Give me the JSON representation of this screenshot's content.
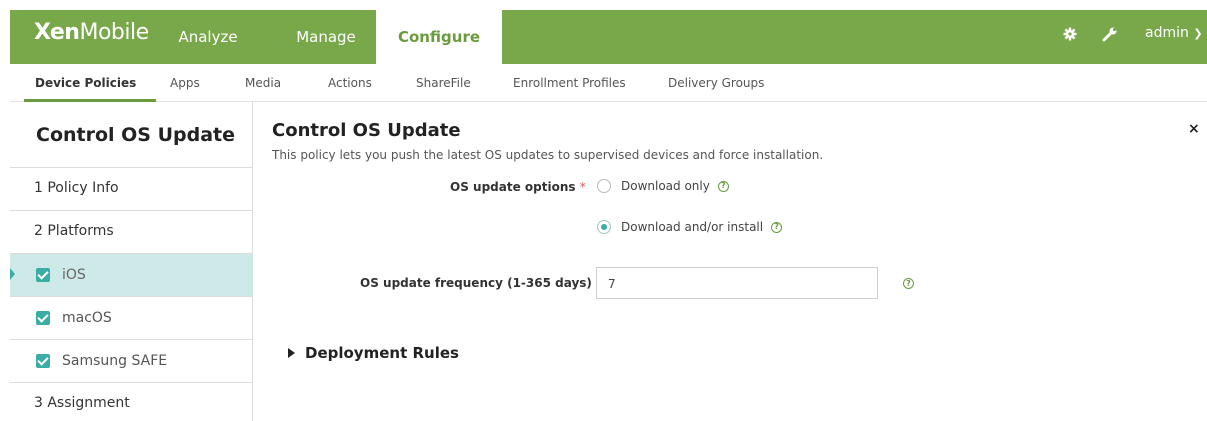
{
  "app": {
    "brand_bold": "Xen",
    "brand_thin": "Mobile"
  },
  "topnav": {
    "analyze": "Analyze",
    "manage": "Manage",
    "configure": "Configure",
    "user": "admin"
  },
  "subnav": [
    "Device Policies",
    "Apps",
    "Media",
    "Actions",
    "ShareFile",
    "Enrollment Profiles",
    "Delivery Groups"
  ],
  "sidebar": {
    "title": "Control OS Update",
    "steps": [
      "1  Policy Info",
      "2  Platforms",
      "3  Assignment"
    ],
    "platforms": [
      "iOS",
      "macOS",
      "Samsung SAFE"
    ]
  },
  "main": {
    "title": "Control OS Update",
    "description": "This policy lets you push the latest OS updates to supervised devices and force installation.",
    "update_options_label": "OS update options",
    "option_download_only": "Download only",
    "option_download_install": "Download and/or install",
    "frequency_label": "OS update frequency (1-365 days)",
    "frequency_value": "7",
    "required_mark": "*",
    "deployment_rules": "Deployment Rules",
    "close": "×",
    "help": "?"
  },
  "colors": {
    "brand_green": "#78a84a",
    "teal": "#3aada5",
    "selected_bg": "#cde9e8"
  }
}
